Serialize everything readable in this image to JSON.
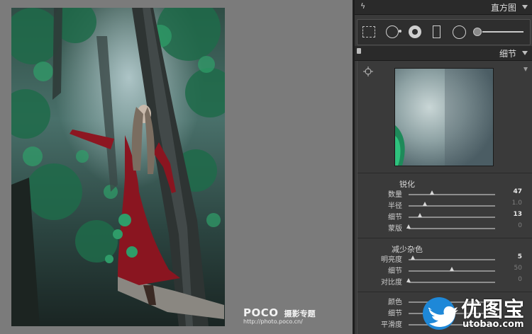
{
  "histogram_panel": {
    "title": "直方图"
  },
  "tools": [
    "crop-overlay",
    "spot-removal",
    "red-eye",
    "graduated-filter",
    "radial-filter",
    "adjustment-brush"
  ],
  "detail_panel": {
    "title": "细节",
    "sharpening": {
      "title": "锐化",
      "sliders": [
        {
          "label": "数量",
          "value": "47",
          "fraction": 0.27,
          "active": true
        },
        {
          "label": "半径",
          "value": "1.0",
          "fraction": 0.19,
          "active": false
        },
        {
          "label": "细节",
          "value": "13",
          "fraction": 0.13,
          "active": true
        },
        {
          "label": "蒙版",
          "value": "0",
          "fraction": 0.0,
          "active": false
        }
      ]
    },
    "noise_reduction": {
      "title": "减少杂色",
      "sliders": [
        {
          "label": "明亮度",
          "value": "5",
          "fraction": 0.05,
          "active": true
        },
        {
          "label": "细节",
          "value": "50",
          "fraction": 0.5,
          "active": false
        },
        {
          "label": "对比度",
          "value": "0",
          "fraction": 0.0,
          "active": false
        }
      ],
      "color_sliders": [
        {
          "label": "颜色"
        },
        {
          "label": "细节"
        },
        {
          "label": "平滑度"
        }
      ]
    }
  },
  "watermark": {
    "logo": "POCO",
    "title": "摄影专题",
    "url": "http://photo.poco.cn/"
  },
  "brand": {
    "name_cn": "优图宝",
    "url": "utobao.com"
  },
  "colors": {
    "accent_blue": "#1e88d8",
    "panel": "#3a3a3a",
    "header": "#2a2a2a"
  }
}
